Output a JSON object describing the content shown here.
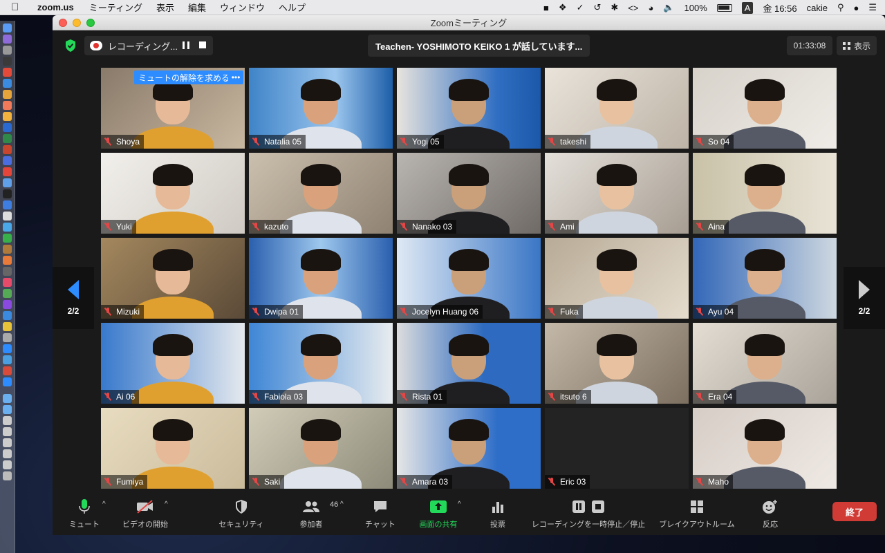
{
  "menubar": {
    "app": "zoom.us",
    "items": [
      "ミーティング",
      "表示",
      "編集",
      "ウィンドウ",
      "ヘルプ"
    ],
    "battery": "100%",
    "input_source": "A",
    "clock": "金 16:56",
    "user": "cakie"
  },
  "window": {
    "title": "Zoomミーティング"
  },
  "topbar": {
    "recording_label": "レコーディング...",
    "speaker": "Teachen- YOSHIMOTO KEIKO 1 が話しています...",
    "timer": "01:33:08",
    "view_label": "表示"
  },
  "gallery": {
    "ask_unmute": "ミュートの解除を求める",
    "more": "•••",
    "pager_left": "2/2",
    "pager_right": "2/2",
    "participants": [
      {
        "name": "Shoya"
      },
      {
        "name": "Natalia 05"
      },
      {
        "name": "Yogi 05"
      },
      {
        "name": "takeshi"
      },
      {
        "name": "So 04"
      },
      {
        "name": "Yuki"
      },
      {
        "name": "kazuto"
      },
      {
        "name": "Nanako 03"
      },
      {
        "name": "Ami"
      },
      {
        "name": "Aina"
      },
      {
        "name": "Mizuki"
      },
      {
        "name": "Dwipa 01"
      },
      {
        "name": "Jocelyn Huang 06"
      },
      {
        "name": "Fuka"
      },
      {
        "name": "Ayu 04"
      },
      {
        "name": "Ai 06"
      },
      {
        "name": "Fabiola 03"
      },
      {
        "name": "Rista 01"
      },
      {
        "name": "itsuto 6"
      },
      {
        "name": "Era 04"
      },
      {
        "name": "Fumiya"
      },
      {
        "name": "Saki"
      },
      {
        "name": "Amara 03"
      },
      {
        "name": "Eric 03"
      },
      {
        "name": "Maho"
      }
    ]
  },
  "toolbar": {
    "mute": "ミュート",
    "video": "ビデオの開始",
    "security": "セキュリティ",
    "participants": "参加者",
    "participants_count": "46",
    "chat": "チャット",
    "share": "画面の共有",
    "poll": "投票",
    "recording": "レコーディングを一時停止／停止",
    "breakout": "ブレイクアウトルーム",
    "reactions": "反応",
    "end": "終了"
  },
  "colors": {
    "accent": "#2d8cff",
    "share_green": "#23d959",
    "end_red": "#d13b36",
    "muted_red": "#e64545"
  }
}
